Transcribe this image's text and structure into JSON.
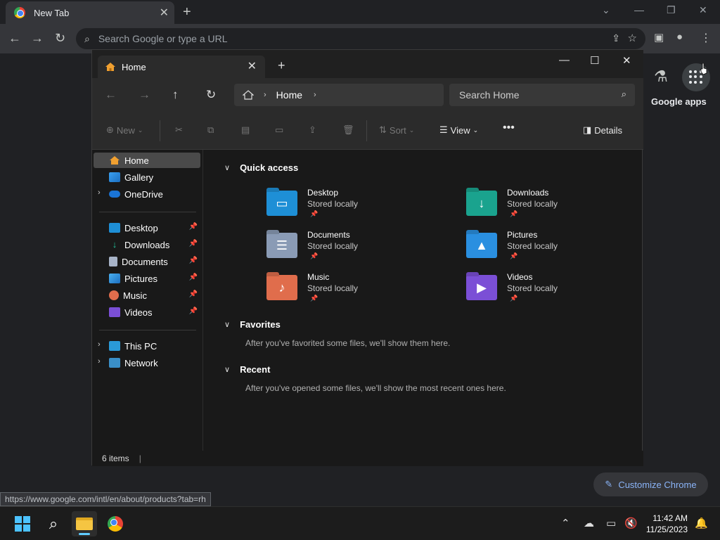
{
  "chrome": {
    "tab_title": "New Tab",
    "omnibox_placeholder": "Search Google or type a URL",
    "apps_label": "Google apps",
    "status_url": "https://www.google.com/intl/en/about/products?tab=rh",
    "customize_label": "Customize Chrome"
  },
  "explorer": {
    "tab_title": "Home",
    "address": {
      "crumb": "Home"
    },
    "search_placeholder": "Search Home",
    "commands": {
      "new": "New",
      "sort": "Sort",
      "view": "View",
      "details": "Details"
    },
    "nav": {
      "top": [
        {
          "label": "Home"
        },
        {
          "label": "Gallery"
        },
        {
          "label": "OneDrive"
        }
      ],
      "pinned": [
        {
          "label": "Desktop"
        },
        {
          "label": "Downloads"
        },
        {
          "label": "Documents"
        },
        {
          "label": "Pictures"
        },
        {
          "label": "Music"
        },
        {
          "label": "Videos"
        }
      ],
      "bottom": [
        {
          "label": "This PC"
        },
        {
          "label": "Network"
        }
      ]
    },
    "sections": {
      "quick_access": {
        "title": "Quick access",
        "items": [
          {
            "name": "Desktop",
            "sub": "Stored locally"
          },
          {
            "name": "Downloads",
            "sub": "Stored locally"
          },
          {
            "name": "Documents",
            "sub": "Stored locally"
          },
          {
            "name": "Pictures",
            "sub": "Stored locally"
          },
          {
            "name": "Music",
            "sub": "Stored locally"
          },
          {
            "name": "Videos",
            "sub": "Stored locally"
          }
        ]
      },
      "favorites": {
        "title": "Favorites",
        "message": "After you've favorited some files, we'll show them here."
      },
      "recent": {
        "title": "Recent",
        "message": "After you've opened some files, we'll show the most recent ones here."
      }
    },
    "status": "6 items"
  },
  "taskbar": {
    "time": "11:42 AM",
    "date": "11/25/2023"
  },
  "colors": {
    "accent": "#60cdff",
    "chrome_link": "#8ab4f8",
    "folder_desktop": "#1e8fd6",
    "folder_downloads": "#1aa38e",
    "folder_documents": "#8a9bb5",
    "folder_pictures": "#2a8fe0",
    "folder_music": "#e06d4c",
    "folder_videos": "#7b4fd6"
  }
}
